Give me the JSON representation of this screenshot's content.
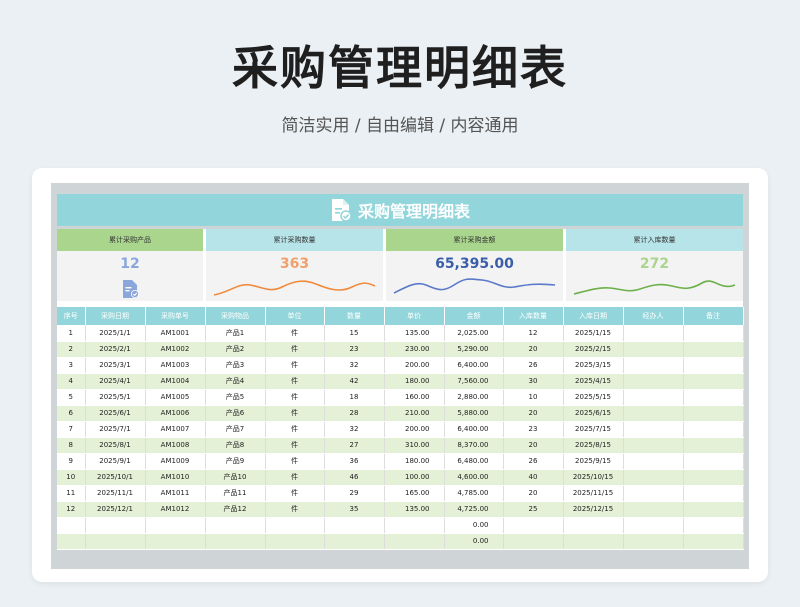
{
  "page": {
    "title": "采购管理明细表",
    "subtitle": "简洁实用 / 自由编辑 / 内容通用"
  },
  "sheet": {
    "banner_title": "采购管理明细表",
    "kpis": [
      {
        "label": "累计采购产品",
        "value": "12",
        "color": "#8aa6db",
        "head": "green"
      },
      {
        "label": "累计采购数量",
        "value": "363",
        "color": "#f0a06a",
        "head": "cyan"
      },
      {
        "label": "累计采购金额",
        "value": "65,395.00",
        "color": "#3a5fa8",
        "head": "green"
      },
      {
        "label": "累计入库数量",
        "value": "272",
        "color": "#a9d58c",
        "head": "cyan"
      }
    ],
    "columns": [
      "序号",
      "采购日期",
      "采购单号",
      "采购物品",
      "单位",
      "数量",
      "单价",
      "金额",
      "入库数量",
      "入库日期",
      "经办人",
      "备注"
    ],
    "rows": [
      [
        "1",
        "2025/1/1",
        "AM1001",
        "产品1",
        "件",
        "15",
        "135.00",
        "2,025.00",
        "12",
        "2025/1/15",
        "",
        ""
      ],
      [
        "2",
        "2025/2/1",
        "AM1002",
        "产品2",
        "件",
        "23",
        "230.00",
        "5,290.00",
        "20",
        "2025/2/15",
        "",
        ""
      ],
      [
        "3",
        "2025/3/1",
        "AM1003",
        "产品3",
        "件",
        "32",
        "200.00",
        "6,400.00",
        "26",
        "2025/3/15",
        "",
        ""
      ],
      [
        "4",
        "2025/4/1",
        "AM1004",
        "产品4",
        "件",
        "42",
        "180.00",
        "7,560.00",
        "30",
        "2025/4/15",
        "",
        ""
      ],
      [
        "5",
        "2025/5/1",
        "AM1005",
        "产品5",
        "件",
        "18",
        "160.00",
        "2,880.00",
        "10",
        "2025/5/15",
        "",
        ""
      ],
      [
        "6",
        "2025/6/1",
        "AM1006",
        "产品6",
        "件",
        "28",
        "210.00",
        "5,880.00",
        "20",
        "2025/6/15",
        "",
        ""
      ],
      [
        "7",
        "2025/7/1",
        "AM1007",
        "产品7",
        "件",
        "32",
        "200.00",
        "6,400.00",
        "23",
        "2025/7/15",
        "",
        ""
      ],
      [
        "8",
        "2025/8/1",
        "AM1008",
        "产品8",
        "件",
        "27",
        "310.00",
        "8,370.00",
        "20",
        "2025/8/15",
        "",
        ""
      ],
      [
        "9",
        "2025/9/1",
        "AM1009",
        "产品9",
        "件",
        "36",
        "180.00",
        "6,480.00",
        "26",
        "2025/9/15",
        "",
        ""
      ],
      [
        "10",
        "2025/10/1",
        "AM1010",
        "产品10",
        "件",
        "46",
        "100.00",
        "4,600.00",
        "40",
        "2025/10/15",
        "",
        ""
      ],
      [
        "11",
        "2025/11/1",
        "AM1011",
        "产品11",
        "件",
        "29",
        "165.00",
        "4,785.00",
        "20",
        "2025/11/15",
        "",
        ""
      ],
      [
        "12",
        "2025/12/1",
        "AM1012",
        "产品12",
        "件",
        "35",
        "135.00",
        "4,725.00",
        "25",
        "2025/12/15",
        "",
        ""
      ],
      [
        "",
        "",
        "",
        "",
        "",
        "",
        "",
        "0.00",
        "",
        "",
        "",
        ""
      ],
      [
        "",
        "",
        "",
        "",
        "",
        "",
        "",
        "0.00",
        "",
        "",
        "",
        ""
      ]
    ]
  }
}
